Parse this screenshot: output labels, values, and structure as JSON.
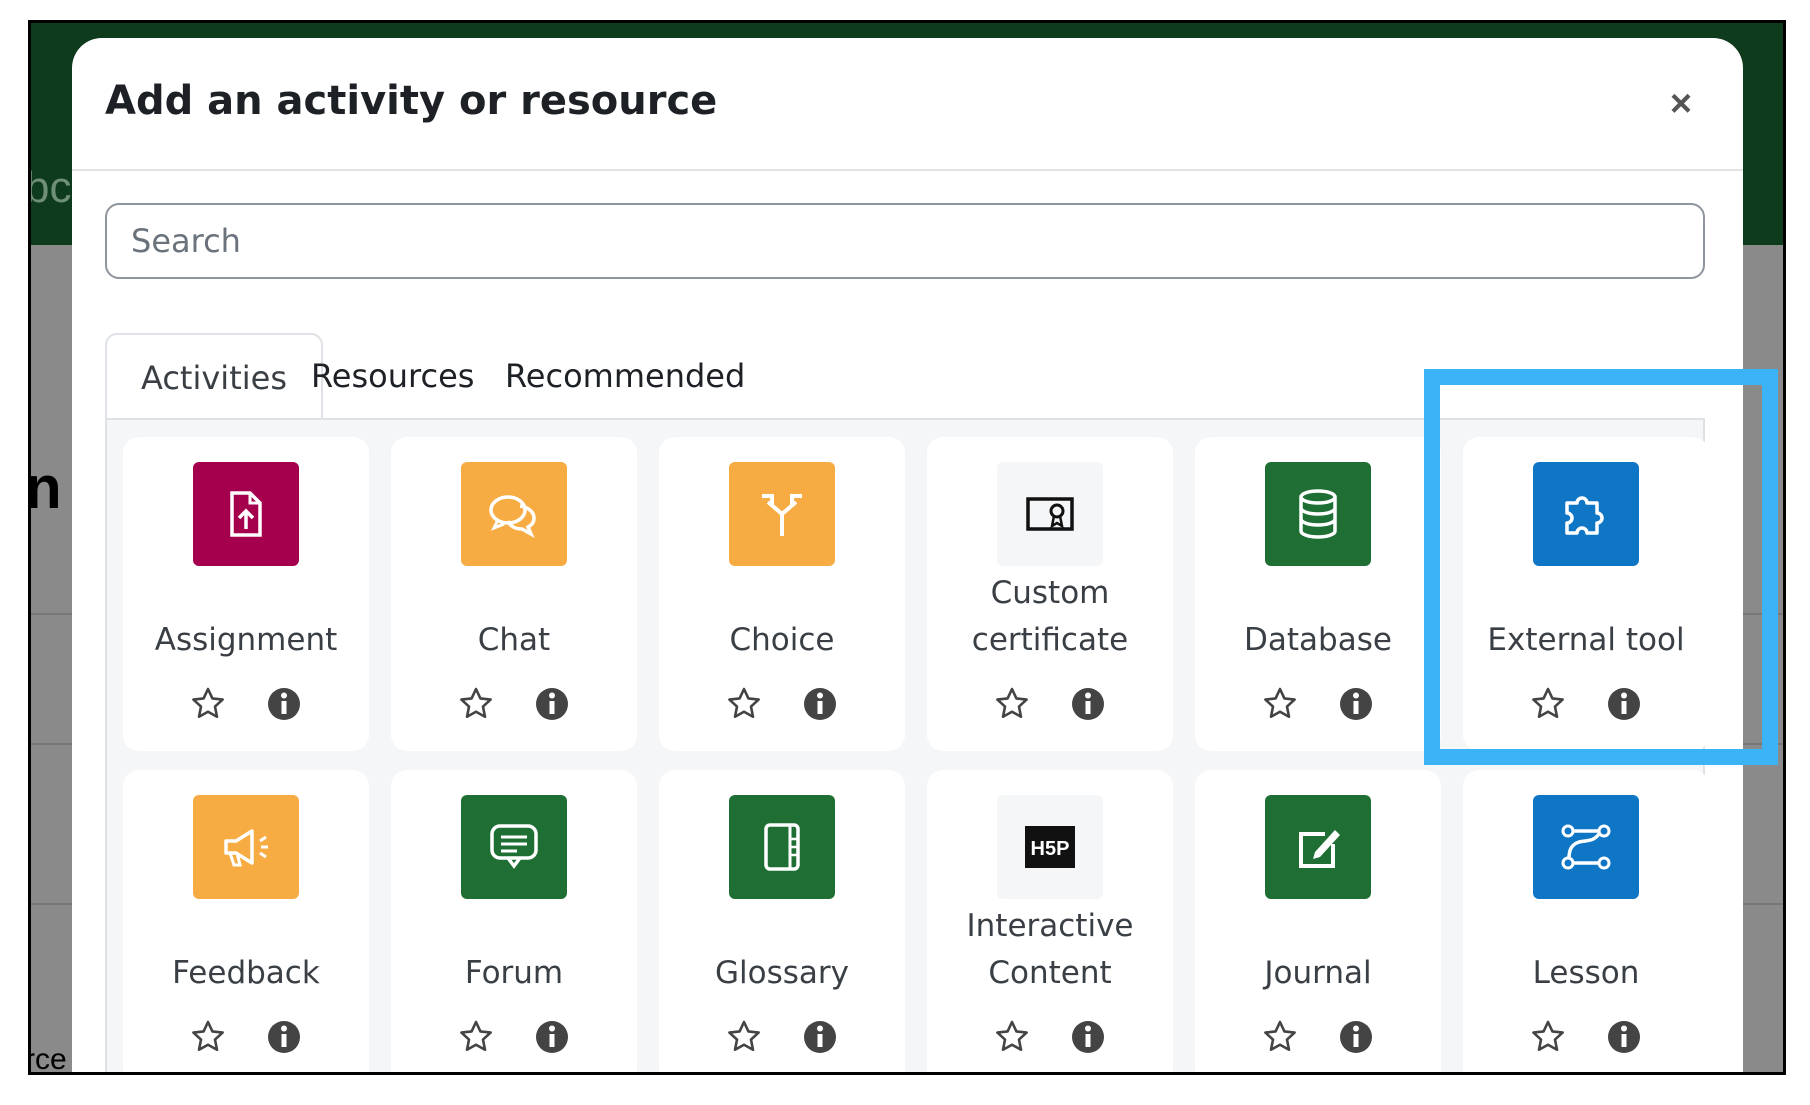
{
  "background": {
    "partial_text_top": "bc",
    "partial_text_mid": "n",
    "partial_text_bottom": "rce"
  },
  "modal": {
    "title": "Add an activity or resource",
    "close_label": "×",
    "search_placeholder": "Search"
  },
  "tabs": [
    {
      "label": "Activities",
      "active": true
    },
    {
      "label": "Resources",
      "active": false
    },
    {
      "label": "Recommended",
      "active": false
    }
  ],
  "activities": [
    {
      "label": "Assignment",
      "icon": "assignment-icon",
      "color": "#a5004d"
    },
    {
      "label": "Chat",
      "icon": "chat-icon",
      "color": "#f7ab43"
    },
    {
      "label": "Choice",
      "icon": "choice-icon",
      "color": "#f7ab43"
    },
    {
      "label": "Custom certificate",
      "icon": "certificate-icon",
      "color": "#f5f6f7"
    },
    {
      "label": "Database",
      "icon": "database-icon",
      "color": "#1f6f34"
    },
    {
      "label": "External tool",
      "icon": "puzzle-icon",
      "color": "#0f76c6"
    },
    {
      "label": "Feedback",
      "icon": "megaphone-icon",
      "color": "#f7ab43"
    },
    {
      "label": "Forum",
      "icon": "forum-icon",
      "color": "#1f6f34"
    },
    {
      "label": "Glossary",
      "icon": "glossary-icon",
      "color": "#1f6f34"
    },
    {
      "label": "Interactive Content",
      "icon": "h5p-icon",
      "color": "#f5f6f7"
    },
    {
      "label": "Journal",
      "icon": "journal-icon",
      "color": "#1f6f34"
    },
    {
      "label": "Lesson",
      "icon": "lesson-icon",
      "color": "#0f76c6"
    }
  ],
  "highlight_color": "#3bb3f6"
}
